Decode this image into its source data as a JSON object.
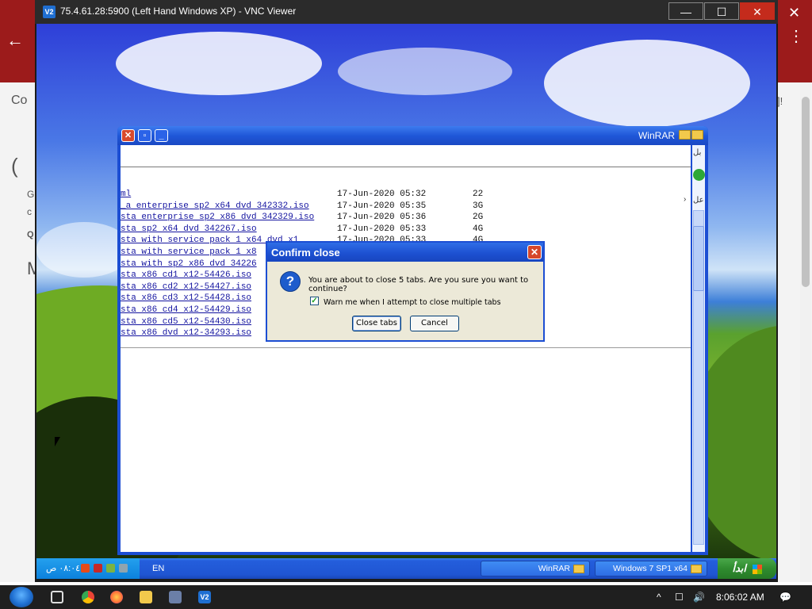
{
  "host": {
    "left_text_top": "Co",
    "left_text_mid": "(",
    "left_text_g": "G",
    "left_text_c": "c",
    "left_text_q": "Q",
    "left_text_m": "M",
    "right_text": "]!"
  },
  "vnc": {
    "app_icon": "V2",
    "title": "75.4.61.28:5900 (Left Hand Windows XP) - VNC Viewer",
    "minimize_glyph": "—",
    "maximize_glyph": "☐",
    "close_glyph": "✕"
  },
  "winrar": {
    "title": "WinRAR",
    "close_glyph": "✕",
    "files": [
      {
        "name": "ml",
        "date": "17-Jun-2020 05:32",
        "size": "22"
      },
      {
        "name": "_a enterprise sp2 x64 dvd 342332.iso",
        "date": "17-Jun-2020 05:35",
        "size": "3G"
      },
      {
        "name": "sta enterprise sp2 x86 dvd 342329.iso",
        "date": "17-Jun-2020 05:36",
        "size": "2G"
      },
      {
        "name": "sta sp2 x64 dvd 342267.iso",
        "date": "17-Jun-2020 05:33",
        "size": "4G"
      },
      {
        "name": "sta with service pack 1 x64 dvd x1",
        "date": "17-Jun-2020 05:33",
        "size": "4G"
      },
      {
        "name": "sta with service pack 1 x8",
        "date": "",
        "size": ""
      },
      {
        "name": "sta with sp2 x86 dvd 34226",
        "date": "",
        "size": ""
      },
      {
        "name": "sta x86 cd1 x12-54426.iso",
        "date": "",
        "size": ""
      },
      {
        "name": "sta x86 cd2 x12-54427.iso",
        "date": "",
        "size": ""
      },
      {
        "name": "sta x86 cd3 x12-54428.iso",
        "date": "",
        "size": ""
      },
      {
        "name": "sta x86 cd4 x12-54429.iso",
        "date": "",
        "size": ""
      },
      {
        "name": "sta x86 cd5 x12-54430.iso",
        "date": "",
        "size": ""
      },
      {
        "name": "sta x86 dvd x12-34293.iso",
        "date": "",
        "size": ""
      }
    ],
    "side_glyph_a": "بل",
    "side_glyph_b": "عل",
    "side_glyph_c": "›"
  },
  "dialog": {
    "title": "Confirm close",
    "close_glyph": "✕",
    "icon": "?",
    "message": "You are about to close 5 tabs. Are you sure you want to continue?",
    "checkbox_label": "Warn me when I attempt to close multiple tabs",
    "checkbox_checked": true,
    "checkbox_glyph": "✓",
    "confirm_button": "Close tabs",
    "cancel_button": "Cancel"
  },
  "xp_taskbar": {
    "clock": "٠٨:٠٤ ص",
    "lang": "EN",
    "tasks": [
      "WinRAR",
      "Windows 7 SP1 x64"
    ],
    "start_label": "ابدأ"
  },
  "w10_taskbar": {
    "clock": "8:06:02 AM",
    "tray_chevron": "^",
    "tray_network": "☐",
    "tray_volume": "🔊",
    "notification_glyph": "💬",
    "vnc_icon": "V2"
  },
  "colors": {
    "xp_blue": "#1c4ed3",
    "dialog_bg": "#ece9d8",
    "link_blue": "#1414a0",
    "host_red": "#9c1b1b",
    "vnc_close_red": "#c42b1c"
  }
}
